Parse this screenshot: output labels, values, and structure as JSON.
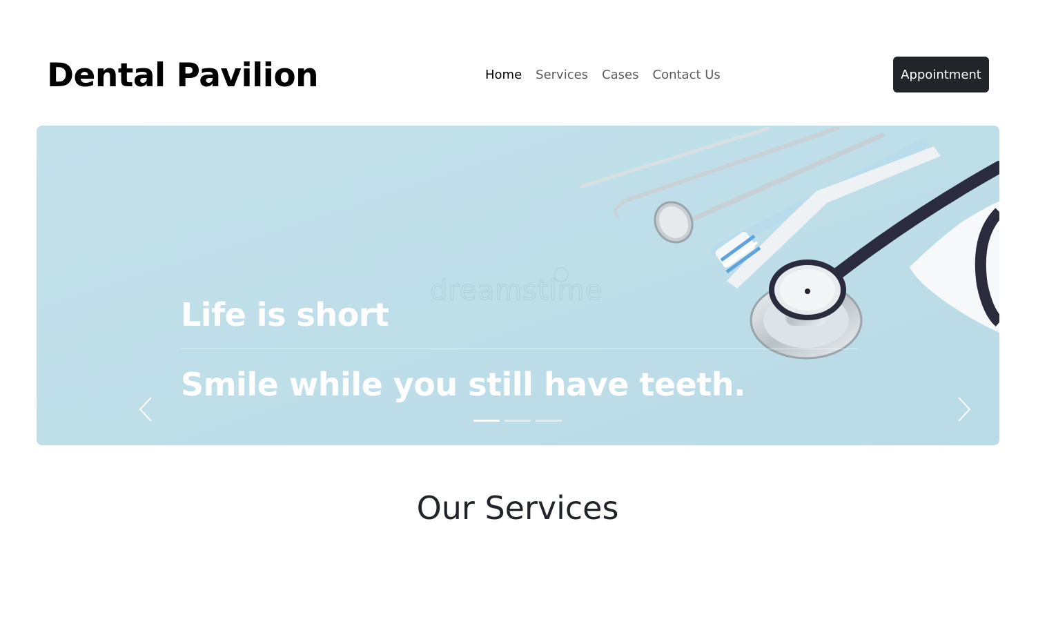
{
  "brand": {
    "name": "Dental Pavilion"
  },
  "nav": {
    "items": [
      {
        "label": "Home",
        "active": true
      },
      {
        "label": "Services",
        "active": false
      },
      {
        "label": "Cases",
        "active": false
      },
      {
        "label": "Contact Us",
        "active": false
      }
    ],
    "cta_label": "Appointment"
  },
  "carousel": {
    "caption_line_1": "Life is short",
    "caption_line_2": "Smile while you still have teeth.",
    "watermark": "dreamstime",
    "slide_count": 3,
    "active_slide": 1,
    "prev_icon": "chevron-left-icon",
    "next_icon": "chevron-right-icon"
  },
  "services": {
    "title": "Our Services"
  },
  "colors": {
    "primary_dark": "#212529",
    "hero_background": "#c0e0ea",
    "text_white": "#ffffff"
  }
}
